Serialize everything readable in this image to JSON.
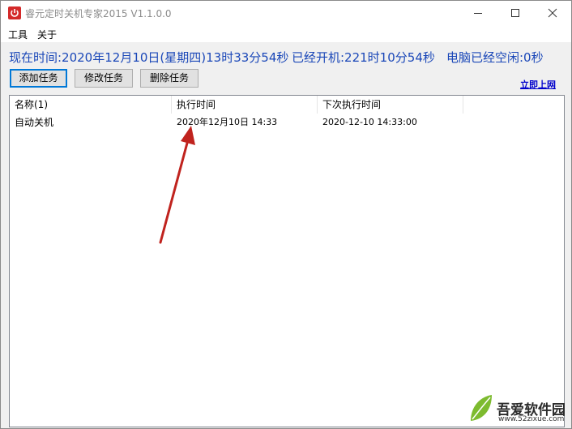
{
  "window": {
    "title": "睿元定时关机专家2015 V1.1.0.0"
  },
  "menu": {
    "tools": "工具",
    "about": "关于"
  },
  "status": {
    "now": "现在时间:2020年12月10日(星期四)13时33分54秒",
    "boot": "已经开机:221时10分54秒",
    "idle": "电脑已经空闲:0秒"
  },
  "toolbar": {
    "add": "添加任务",
    "edit": "修改任务",
    "delete": "删除任务",
    "online": "立即上网"
  },
  "table": {
    "columns": [
      "名称(1)",
      "执行时间",
      "下次执行时间"
    ],
    "rows": [
      {
        "name": "自动关机",
        "exec_time": "2020年12月10日 14:33",
        "next_time": "2020-12-10 14:33:00"
      }
    ]
  },
  "watermark": {
    "title": "吾爱软件园",
    "site": "www.52zixue.com"
  },
  "colors": {
    "status_text": "#1a47b8",
    "app_icon": "#d42a2a",
    "annotation_arrow": "#c0231e"
  },
  "icons": {
    "app": "power-icon",
    "minimize": "minimize-icon",
    "maximize": "maximize-icon",
    "close": "close-icon"
  }
}
